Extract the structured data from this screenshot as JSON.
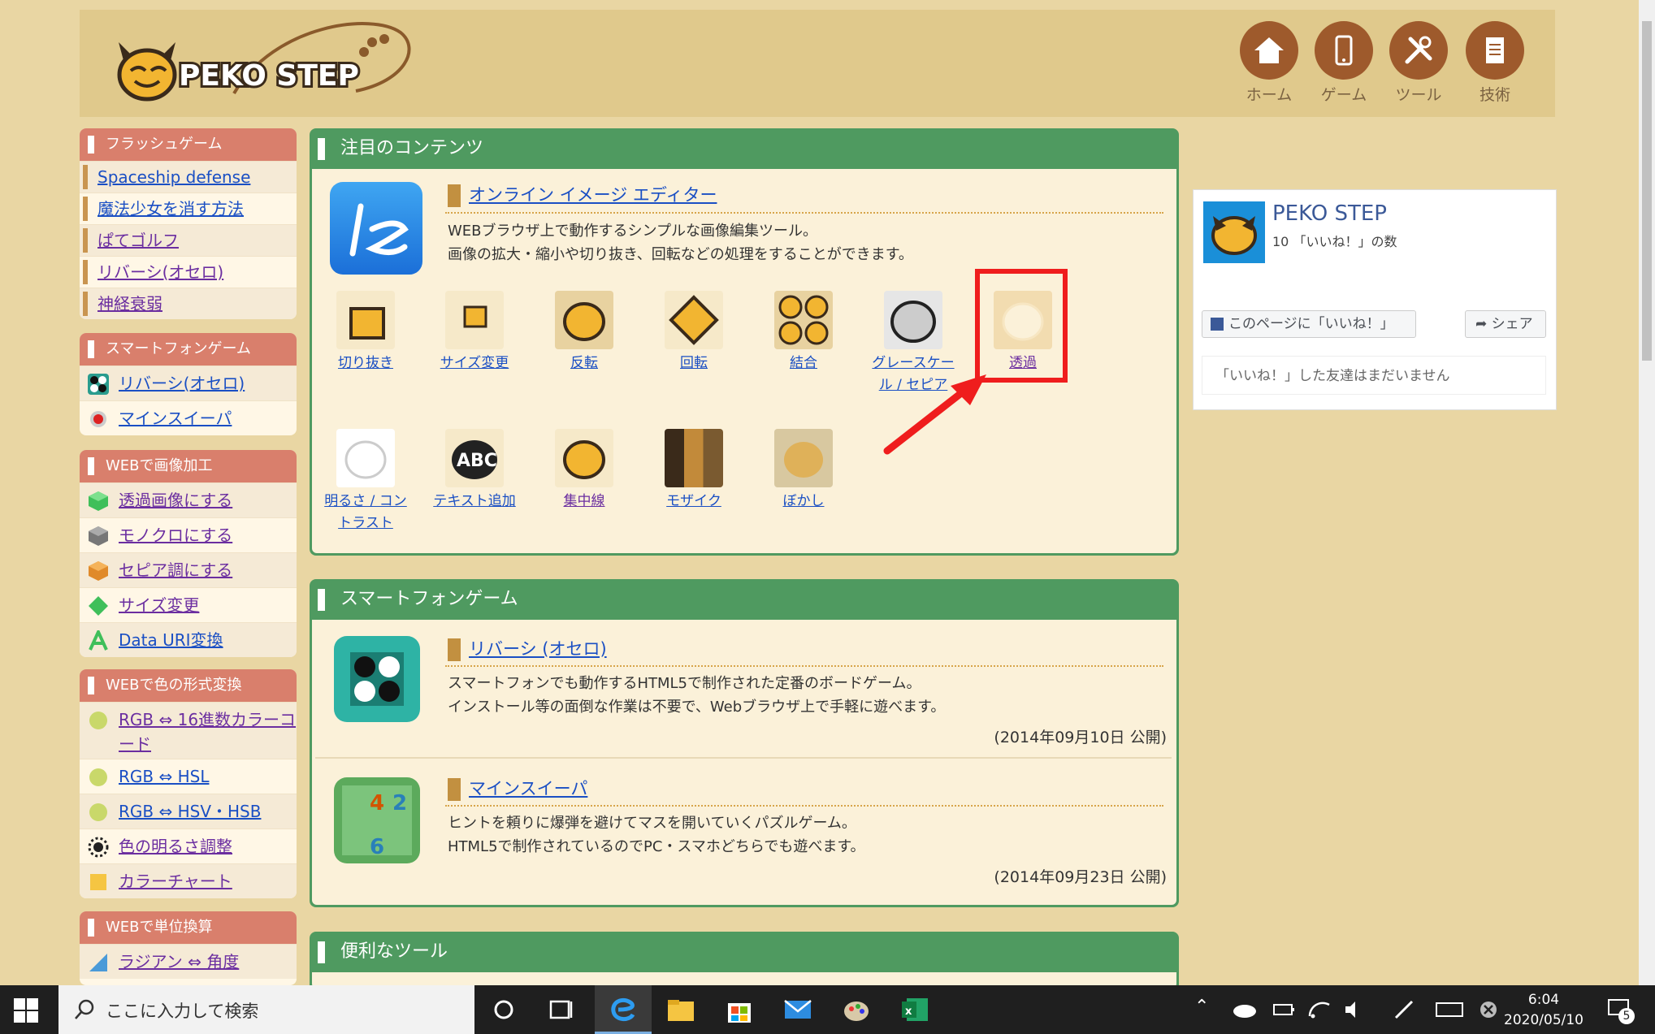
{
  "header": {
    "logo_text": "PEKO STEP",
    "nav": [
      "ホーム",
      "ゲーム",
      "ツール",
      "技術"
    ]
  },
  "sidebar": {
    "flash": {
      "title": "フラッシュゲーム",
      "items": [
        "Spaceship defense",
        "魔法少女を消す方法",
        "ぱてゴルフ",
        "リバーシ(オセロ)",
        "神経衰弱"
      ]
    },
    "smartphone": {
      "title": "スマートフォンゲーム",
      "items": [
        "リバーシ(オセロ)",
        "マインスイーパ"
      ]
    },
    "image": {
      "title": "WEBで画像加工",
      "items": [
        "透過画像にする",
        "モノクロにする",
        "セピア調にする",
        "サイズ変更",
        "Data URI変換"
      ]
    },
    "color": {
      "title": "WEBで色の形式変換",
      "items": [
        "RGB ⇔ 16進数カラーコード",
        "RGB ⇔ HSL",
        "RGB ⇔ HSV・HSB",
        "色の明るさ調整",
        "カラーチャート"
      ]
    },
    "unit": {
      "title": "WEBで単位換算",
      "items": [
        "ラジアン ⇔ 角度"
      ]
    }
  },
  "featured": {
    "title": "注目のコンテンツ",
    "editor_title": "オンライン イメージ エディター",
    "desc1": "WEBブラウザ上で動作するシンプルな画像編集ツール。",
    "desc2": "画像の拡大・縮小や切り抜き、回転などの処理をすることができます。",
    "tools_row1": [
      "切り抜き",
      "サイズ変更",
      "反転",
      "回転",
      "結合",
      "グレースケール / セピア",
      "透過"
    ],
    "tools_row2": [
      "明るさ / コントラスト",
      "テキスト追加",
      "集中線",
      "モザイク",
      "ぼかし"
    ]
  },
  "phone_games": {
    "title": "スマートフォンゲーム",
    "reversi": {
      "title": "リバーシ (オセロ)",
      "desc1": "スマートフォンでも動作するHTML5で制作された定番のボードゲーム。",
      "desc2": "インストール等の面倒な作業は不要で、Webブラウザ上で手軽に遊べます。",
      "date": "(2014年09月10日 公開)"
    },
    "mines": {
      "title": "マインスイーパ",
      "desc1": "ヒントを頼りに爆弾を避けてマスを開いていくパズルゲーム。",
      "desc2": "HTML5で制作されているのでPC・スマホどちらでも遊べます。",
      "date": "(2014年09月23日 公開)"
    }
  },
  "tools_panel": {
    "title": "便利なツール"
  },
  "facebook": {
    "page_name": "PEKO STEP",
    "likes": "10 「いいね！」の数",
    "like_button": "このページに「いいね！」",
    "share_button": "シェア",
    "footer": "「いいね！」した友達はまだいません"
  },
  "taskbar": {
    "search_placeholder": "ここに入力して検索",
    "time": "6:04",
    "date": "2020/05/10",
    "notification_count": "5"
  },
  "colors": {
    "page_bg": "#e9d6a3",
    "sidebar_header": "#d97f6c",
    "panel_header": "#4f9a60",
    "highlight": "#ef1d1d"
  }
}
